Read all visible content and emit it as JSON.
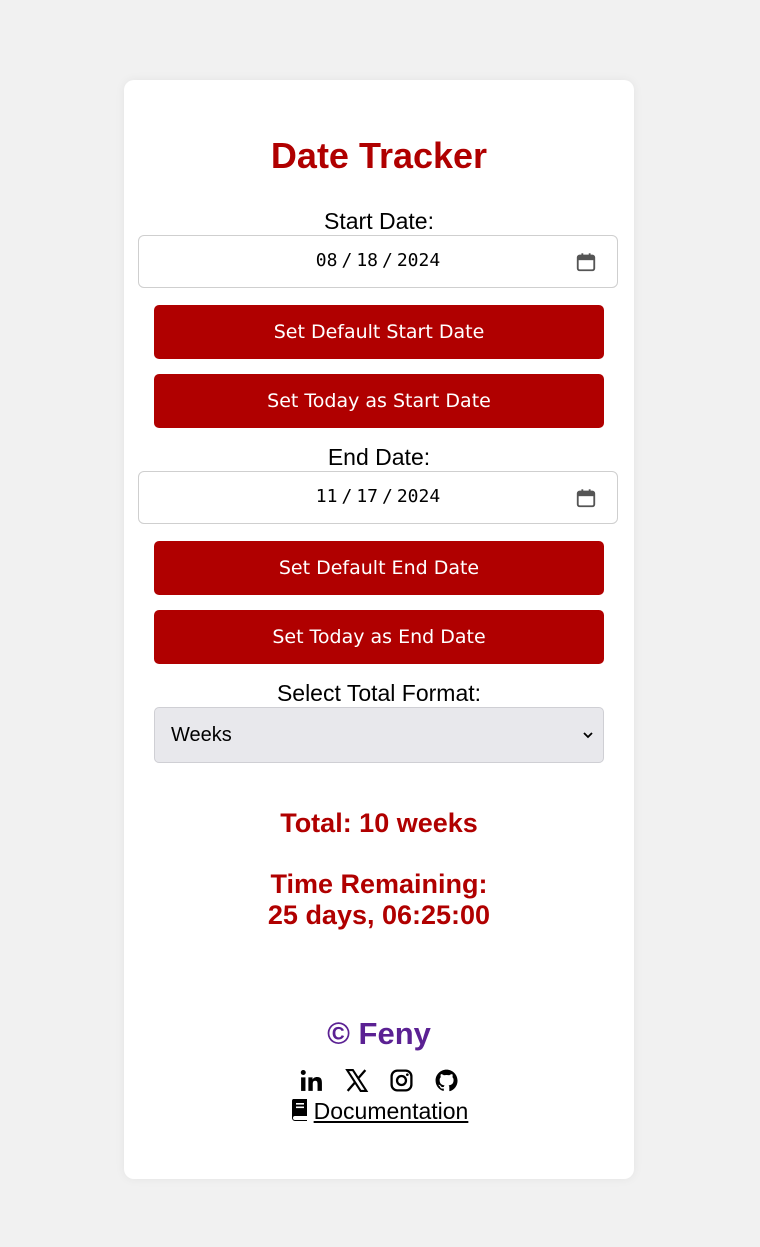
{
  "app": {
    "title": "Date Tracker"
  },
  "start": {
    "label": "Start Date:",
    "month": "08",
    "day": "18",
    "year": "2024",
    "btn_default": "Set Default Start Date",
    "btn_today": "Set Today as Start Date"
  },
  "end": {
    "label": "End Date:",
    "month": "11",
    "day": "17",
    "year": "2024",
    "btn_default": "Set Default End Date",
    "btn_today": "Set Today as End Date"
  },
  "format": {
    "label": "Select Total Format:",
    "selected": "Weeks"
  },
  "result": {
    "total": "Total: 10 weeks",
    "remaining_label": "Time Remaining:",
    "remaining_value": "25 days, 06:25:00"
  },
  "footer": {
    "copyright": "© Feny",
    "documentation": "Documentation",
    "socials": [
      "linkedin-icon",
      "x-icon",
      "instagram-icon",
      "github-icon"
    ]
  },
  "colors": {
    "accent": "#b00000",
    "brand": "#5b2193",
    "background": "#f1f1f1"
  }
}
